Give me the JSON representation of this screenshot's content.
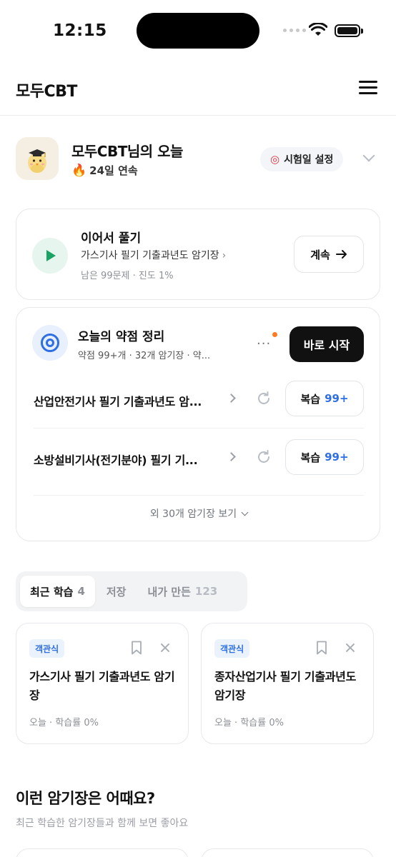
{
  "status_bar": {
    "time": "12:15"
  },
  "header": {
    "logo": "모두CBT"
  },
  "profile": {
    "greeting": "모두CBT님의 오늘",
    "streak": "24일 연속",
    "exam_button": "시험일 설정"
  },
  "resume": {
    "title": "이어서 풀기",
    "subtitle": "가스기사 필기 기출과년도 암기장",
    "meta": "남은 99문제 · 진도 1%",
    "button": "계속"
  },
  "weak": {
    "title": "오늘의 약점 정리",
    "subtitle": "약점 99+개 · 32개 암기장 · 약...",
    "start_button": "바로 시작",
    "decks": [
      {
        "name": "산업안전기사 필기 기출과년도 암...",
        "review_label": "복습",
        "review_count": "99+"
      },
      {
        "name": "소방설비기사(전기분야) 필기 기...",
        "review_label": "복습",
        "review_count": "99+"
      }
    ],
    "more": "외 30개 암기장 보기"
  },
  "tabs": [
    {
      "label": "최근 학습",
      "count": "4"
    },
    {
      "label": "저장",
      "count": ""
    },
    {
      "label": "내가 만든",
      "count": "123"
    }
  ],
  "recent": [
    {
      "tag": "객관식",
      "title": "가스기사 필기 기출과년도 암기장",
      "meta": "오늘 · 학습률 0%"
    },
    {
      "tag": "객관식",
      "title": "종자산업기사 필기 기출과년도 암기장",
      "meta": "오늘 · 학습률 0%"
    }
  ],
  "recommend": {
    "title": "이런 암기장은 어때요?",
    "subtitle": "최근 학습한 암기장들과 함께 보면 좋아요"
  }
}
